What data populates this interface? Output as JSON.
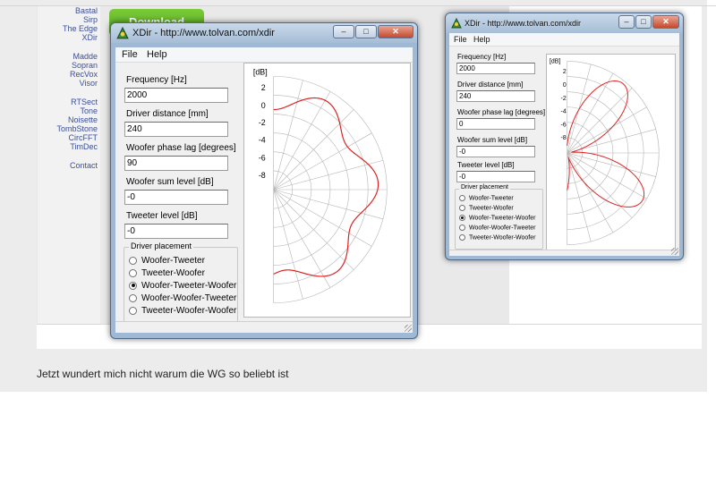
{
  "page": {
    "nav_group1": [
      "Bastal",
      "Sirp",
      "The Edge",
      "XDir"
    ],
    "nav_group2": [
      "Madde",
      "Sopran",
      "RecVox",
      "Visor"
    ],
    "nav_group3": [
      "RTSect",
      "Tone",
      "Noisette",
      "TombStone",
      "CircFFT",
      "TimDec"
    ],
    "nav_group4": [
      "Contact"
    ],
    "download_label": "Download",
    "caption": "Jetzt wundert mich nicht warum die WG so beliebt ist"
  },
  "window_main": {
    "title": "XDir - http://www.tolvan.com/xdir",
    "menu": [
      "File",
      "Help"
    ],
    "fields": [
      {
        "label": "Frequency [Hz]",
        "value": "2000"
      },
      {
        "label": "Driver distance [mm]",
        "value": "240"
      },
      {
        "label": "Woofer phase lag [degrees]",
        "value": "90"
      },
      {
        "label": "Woofer sum level [dB]",
        "value": "-0"
      },
      {
        "label": "Tweeter level [dB]",
        "value": "-0"
      }
    ],
    "placement_title": "Driver placement",
    "placement_options": [
      "Woofer-Tweeter",
      "Tweeter-Woofer",
      "Woofer-Tweeter-Woofer",
      "Woofer-Woofer-Tweeter",
      "Tweeter-Woofer-Woofer"
    ],
    "placement_selected": 2,
    "plot_unit": "[dB]",
    "plot_ticks": [
      "2",
      "0",
      "-2",
      "-4",
      "-6",
      "-8"
    ]
  },
  "window_secondary": {
    "title": "XDir - http://www.tolvan.com/xdir",
    "menu": [
      "File",
      "Help"
    ],
    "fields": [
      {
        "label": "Frequency [Hz]",
        "value": "2000"
      },
      {
        "label": "Driver distance [mm]",
        "value": "240"
      },
      {
        "label": "Woofer phase lag [degrees]",
        "value": "0"
      },
      {
        "label": "Woofer sum level [dB]",
        "value": "-0"
      },
      {
        "label": "Tweeter level [dB]",
        "value": "-0"
      }
    ],
    "placement_title": "Driver placement",
    "placement_options": [
      "Woofer-Tweeter",
      "Tweeter-Woofer",
      "Woofer-Tweeter-Woofer",
      "Woofer-Woofer-Tweeter",
      "Tweeter-Woofer-Woofer"
    ],
    "placement_selected": 2,
    "plot_unit": "[dB]",
    "plot_ticks": [
      "2",
      "0",
      "-2",
      "-4",
      "-6",
      "-8"
    ]
  },
  "colors": {
    "curve": "#e02020",
    "grid": "#b4b4b4",
    "nav_link": "#3a4f9a",
    "download_green": "#5fb32a"
  },
  "icons": [
    "xdir-app-icon",
    "minimize-icon",
    "maximize-icon",
    "close-icon",
    "resize-grip-icon"
  ]
}
